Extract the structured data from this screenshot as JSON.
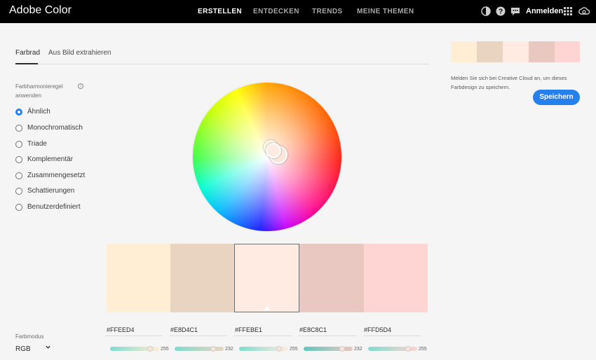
{
  "header": {
    "app_title": "Adobe Color",
    "nav": [
      "ERSTELLEN",
      "ENTDECKEN",
      "TRENDS",
      "MEINE THEMEN"
    ],
    "login_label": "Anmelden",
    "icons": [
      "theme-toggle-icon",
      "help-icon",
      "feedback-icon",
      "apps-grid-icon",
      "creative-cloud-icon"
    ]
  },
  "tabs": [
    "Farbrad",
    "Aus Bild extrahieren"
  ],
  "harmony": {
    "title": "Farbharmonieregel anwenden",
    "info": "i",
    "options": [
      "Ähnlich",
      "Monochromatisch",
      "Triade",
      "Komplementär",
      "Zusammengesetzt",
      "Schattierungen",
      "Benutzerdefiniert"
    ],
    "selected": "Ähnlich"
  },
  "swatches": [
    {
      "hex": "#FFEED4",
      "color": "#FFEED4",
      "slider_value": "255",
      "slider_fraction": 0.86
    },
    {
      "hex": "#E8D4C1",
      "color": "#E8D4C1",
      "slider_value": "232",
      "slider_fraction": 0.83
    },
    {
      "hex": "#FFEBE1",
      "color": "#FFEBE1",
      "slider_value": "255",
      "slider_fraction": 0.86
    },
    {
      "hex": "#E8C8C1",
      "color": "#E8C8C1",
      "slider_value": "232",
      "slider_fraction": 0.83
    },
    {
      "hex": "#FFD5D4",
      "color": "#FFD5D4",
      "slider_value": "255",
      "slider_fraction": 0.86
    }
  ],
  "farbmodus": {
    "label": "Farbmodus",
    "value": "RGB"
  },
  "right_panel": {
    "message": "Melden Sie sich bei Creative Cloud an, um dieses Farbdesign zu speichern.",
    "save_label": "Speichern"
  },
  "colors": {
    "accent": "#2680eb",
    "topbar": "#000000",
    "background": "#f5f5f5"
  }
}
